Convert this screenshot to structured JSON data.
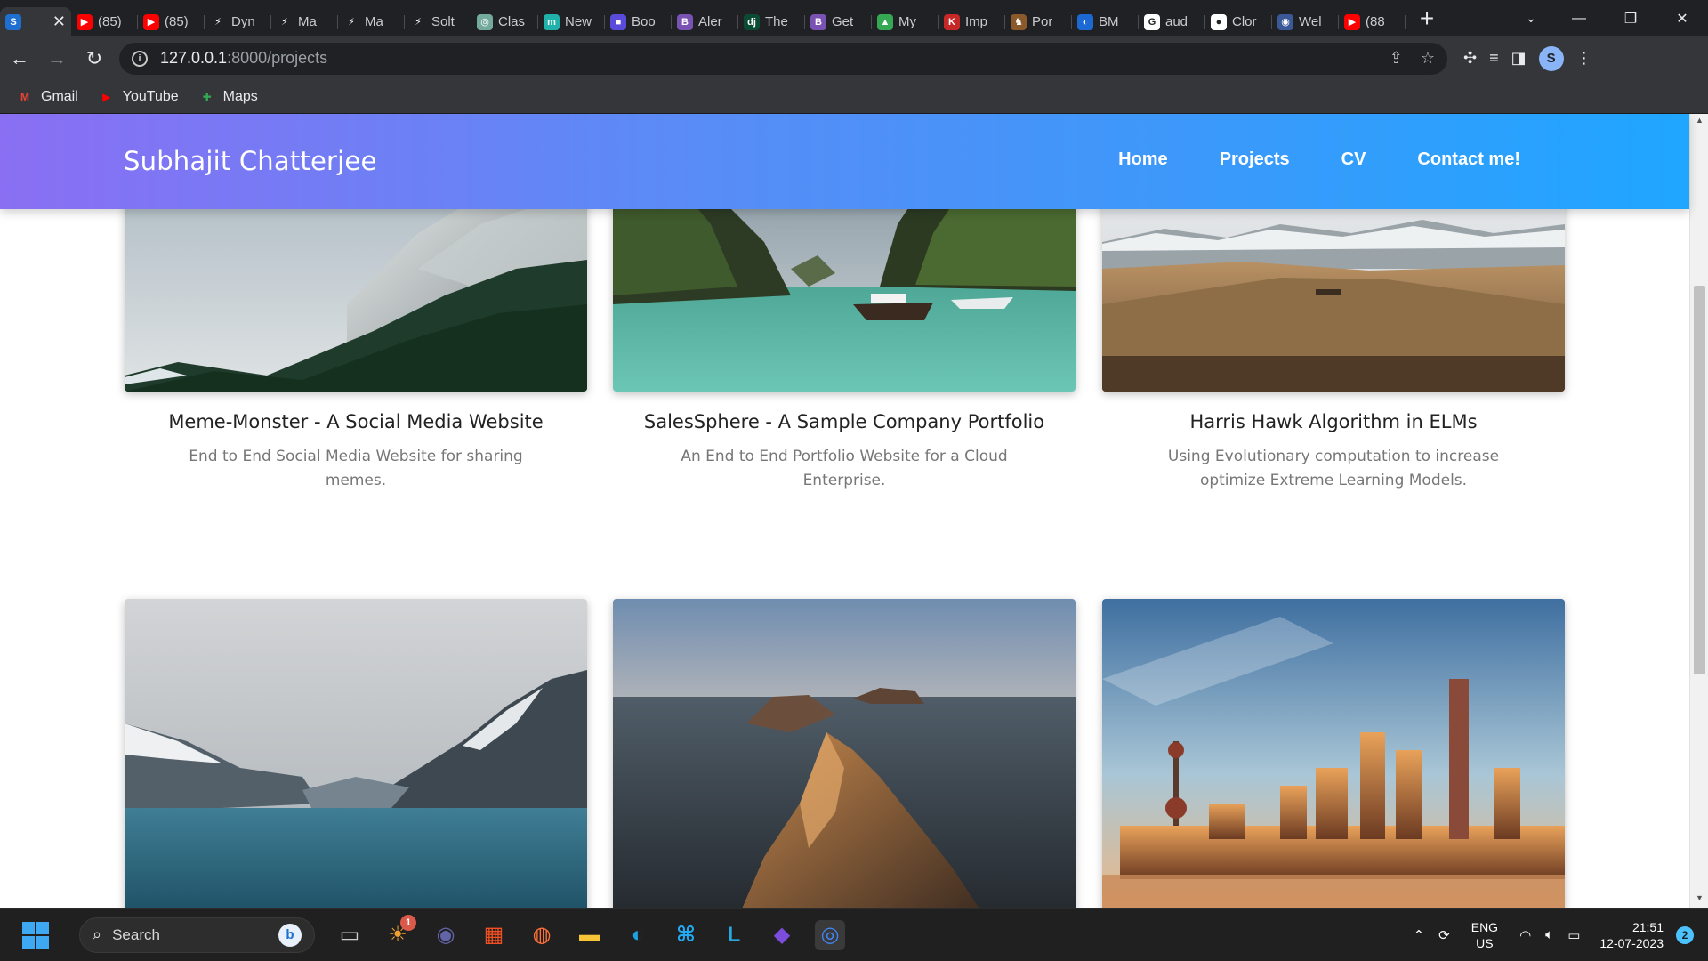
{
  "browser": {
    "tabs": [
      {
        "title": "",
        "icon": "dynamic-favicon",
        "color": "#1f6fd1",
        "glyph": "S",
        "active": true
      },
      {
        "title": "(85)",
        "icon": "youtube-icon",
        "color": "#ff0000",
        "glyph": "▶"
      },
      {
        "title": "(85)",
        "icon": "youtube-icon",
        "color": "#ff0000",
        "glyph": "▶"
      },
      {
        "title": "Dyn",
        "icon": "dynamic-icon",
        "color": "#202124",
        "glyph": "⚡"
      },
      {
        "title": "Ma",
        "icon": "dynamic-icon",
        "color": "#202124",
        "glyph": "⚡"
      },
      {
        "title": "Ma",
        "icon": "dynamic-icon",
        "color": "#202124",
        "glyph": "⚡"
      },
      {
        "title": "Solt",
        "icon": "dynamic-icon",
        "color": "#202124",
        "glyph": "⚡"
      },
      {
        "title": "Clas",
        "icon": "openai-icon",
        "color": "#74aa9c",
        "glyph": "◎"
      },
      {
        "title": "New",
        "icon": "m-icon",
        "color": "#20b2aa",
        "glyph": "m"
      },
      {
        "title": "Boo",
        "icon": "book-icon",
        "color": "#5b4bdb",
        "glyph": "■"
      },
      {
        "title": "Aler",
        "icon": "bootstrap-icon",
        "color": "#7952b3",
        "glyph": "B"
      },
      {
        "title": "The",
        "icon": "django-icon",
        "color": "#0c4b33",
        "glyph": "dj"
      },
      {
        "title": "Get",
        "icon": "bootstrap-icon",
        "color": "#7952b3",
        "glyph": "B"
      },
      {
        "title": "My",
        "icon": "google-drive-icon",
        "color": "#34a853",
        "glyph": "▲"
      },
      {
        "title": "Imp",
        "icon": "k-icon",
        "color": "#c62828",
        "glyph": "K"
      },
      {
        "title": "Por",
        "icon": "porsche-icon",
        "color": "#8b5a2b",
        "glyph": "♞"
      },
      {
        "title": "BM",
        "icon": "bmw-icon",
        "color": "#1c69d4",
        "glyph": "◐"
      },
      {
        "title": "aud",
        "icon": "google-icon",
        "color": "#ffffff",
        "glyph": "G"
      },
      {
        "title": "Clor",
        "icon": "github-icon",
        "color": "#ffffff",
        "glyph": "●"
      },
      {
        "title": "Wel",
        "icon": "web-icon",
        "color": "#3b5998",
        "glyph": "◉"
      },
      {
        "title": "(88",
        "icon": "youtube-icon",
        "color": "#ff0000",
        "glyph": "▶"
      }
    ],
    "url_host": "127.0.0.1",
    "url_path": ":8000/projects",
    "profile_initial": "S",
    "bookmarks": [
      {
        "label": "Gmail",
        "icon": "gmail-icon",
        "color": "#ea4335",
        "glyph": "M"
      },
      {
        "label": "YouTube",
        "icon": "youtube-icon",
        "color": "#ff0000",
        "glyph": "▶"
      },
      {
        "label": "Maps",
        "icon": "maps-icon",
        "color": "#34a853",
        "glyph": "✚"
      }
    ]
  },
  "site": {
    "brand": "Subhajit Chatterjee",
    "nav": [
      "Home",
      "Projects",
      "CV",
      "Contact me!"
    ],
    "colors": {
      "gradient_start": "#8a6ff3",
      "gradient_end": "#1fa6ff"
    },
    "projects": [
      {
        "title": "Meme-Monster - A Social Media Website",
        "desc": "End to End Social Media Website for sharing memes.",
        "scene": "snowy-mountain-forest"
      },
      {
        "title": "SalesSphere - A Sample Company Portfolio",
        "desc": "An End to End Portfolio Website for a Cloud Enterprise.",
        "scene": "tropical-lagoon-boats"
      },
      {
        "title": "Harris Hawk Algorithm in ELMs",
        "desc": "Using Evolutionary computation to increase optimize Extreme Learning Models.",
        "scene": "highland-plains"
      },
      {
        "title": "",
        "desc": "",
        "scene": "mountain-lake"
      },
      {
        "title": "",
        "desc": "",
        "scene": "sea-rock-islands"
      },
      {
        "title": "",
        "desc": "",
        "scene": "city-skyline-sunset"
      }
    ]
  },
  "taskbar": {
    "search_placeholder": "Search",
    "apps": [
      {
        "name": "task-view",
        "color": "#cfcfcf",
        "glyph": "▭"
      },
      {
        "name": "widgets",
        "color": "#f0a030",
        "glyph": "☀",
        "badge": "1"
      },
      {
        "name": "teams-chat",
        "color": "#6264a7",
        "glyph": "◉"
      },
      {
        "name": "microsoft-store",
        "color": "#f25022",
        "glyph": "▦"
      },
      {
        "name": "firefox",
        "color": "#ff7139",
        "glyph": "◍"
      },
      {
        "name": "file-explorer",
        "color": "#f8c537",
        "glyph": "▬"
      },
      {
        "name": "edge",
        "color": "#1fa0e3",
        "glyph": "◐"
      },
      {
        "name": "vscode",
        "color": "#23a9f2",
        "glyph": "⌘"
      },
      {
        "name": "l-app",
        "color": "#29a9e0",
        "glyph": "L"
      },
      {
        "name": "obsidian",
        "color": "#7c4ddc",
        "glyph": "◆"
      },
      {
        "name": "chrome",
        "color": "#4285f4",
        "glyph": "◎",
        "active": true
      }
    ],
    "lang_top": "ENG",
    "lang_bottom": "US",
    "time": "21:51",
    "date": "12-07-2023",
    "notifications": "2"
  }
}
